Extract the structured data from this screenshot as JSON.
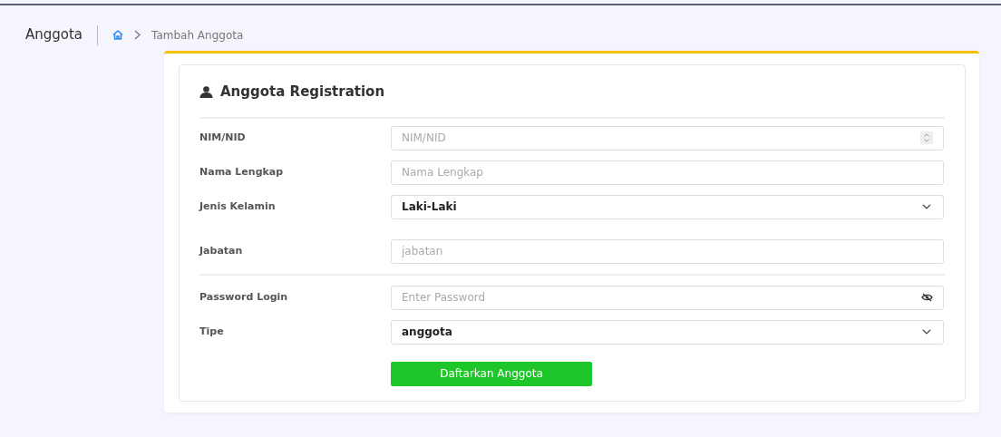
{
  "breadcrumb": {
    "title": "Anggota",
    "current": "Tambah Anggota"
  },
  "form": {
    "title": "Anggota Registration",
    "fields": [
      {
        "kind": "number",
        "label": "NIM/NID",
        "placeholder": "NIM/NID"
      },
      {
        "kind": "text",
        "label": "Nama Lengkap",
        "placeholder": "Nama Lengkap"
      },
      {
        "kind": "select",
        "label": "Jenis Kelamin",
        "value": "Laki-Laki"
      },
      {
        "kind": "text",
        "label": "Jabatan",
        "placeholder": "jabatan"
      },
      {
        "kind": "password",
        "label": "Password Login",
        "placeholder": "Enter Password",
        "divider_before": true
      },
      {
        "kind": "select",
        "label": "Tipe",
        "value": "anggota"
      }
    ],
    "submit": "Daftarkan Anggota"
  }
}
